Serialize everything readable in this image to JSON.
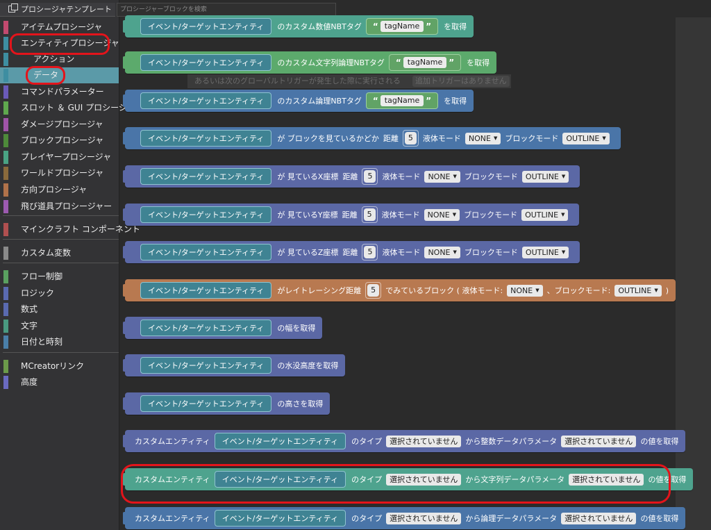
{
  "sidebar": {
    "template_tab": "プロシージャテンプレート",
    "categories": [
      {
        "label": "アイテムプロシージャ",
        "color": "#c24a6f"
      },
      {
        "label": "エンティティプロシージャ",
        "color": "#3e8ea1"
      },
      {
        "label": "アクション",
        "color": "#3e8ea1"
      },
      {
        "label": "データ",
        "color": "#3e8ea1"
      },
      {
        "label": "コマンドパラメーター",
        "color": "#6a5ab8"
      },
      {
        "label": "スロット ＆ GUI プロシージャ",
        "color": "#5fa84e"
      },
      {
        "label": "ダメージプロシージャ",
        "color": "#a054a8"
      },
      {
        "label": "ブロックプロシージャ",
        "color": "#4e8a3a"
      },
      {
        "label": "プレイヤープロシージャ",
        "color": "#4aa384"
      },
      {
        "label": "ワールドプロシージャ",
        "color": "#8a6a3c"
      },
      {
        "label": "方向プロシージャ",
        "color": "#b0724a"
      },
      {
        "label": "飛び道具プロシージャー",
        "color": "#9c5ab0"
      },
      {
        "label": "マインクラフト コンポーネント",
        "color": "#b05050"
      },
      {
        "label": "カスタム変数",
        "color": "#8a8a8a"
      },
      {
        "label": "フロー制御",
        "color": "#5aa060"
      },
      {
        "label": "ロジック",
        "color": "#5a6ab0"
      },
      {
        "label": "数式",
        "color": "#5a6ab0"
      },
      {
        "label": "文字",
        "color": "#4a9a80"
      },
      {
        "label": "日付と時刻",
        "color": "#4a7fa8"
      },
      {
        "label": "MCreatorリンク",
        "color": "#6b9a4a"
      },
      {
        "label": "高度",
        "color": "#6a6ac0"
      }
    ]
  },
  "search": {
    "placeholder": "プロシージャーブロックを検索"
  },
  "ghost": {
    "text": "あるいは次のグローバルトリガーが発生した際に実行される",
    "trigger": "追加トリガーはありません"
  },
  "common": {
    "entity": "イベント/ターゲットエンティティ",
    "custom_entity": "カスタムエンティティ",
    "tagname": "tagName",
    "five": "5",
    "none": "NONE",
    "outline": "OUTLINE",
    "not_selected": "選択されていません",
    "fluid_mode": "液体モード",
    "block_mode": "ブロックモード",
    "get": "を取得",
    "distance": "距離",
    "type_of": "のタイプ",
    "value_get": "の値を取得"
  },
  "blocks": {
    "b1": {
      "text": "のカスタム数値NBTタグ"
    },
    "b2": {
      "text": "のカスタム文字列論理NBTタグ"
    },
    "b3": {
      "text": "のカスタム論理NBTタグ"
    },
    "b4": {
      "text": "が ブロックを見ているかどか"
    },
    "b5": {
      "text": "が 見ているX座標"
    },
    "b6": {
      "text": "が 見ているY座標"
    },
    "b7": {
      "text": "が 見ているZ座標"
    },
    "b8": {
      "text": "がレイトレーシング距離",
      "text2": "でみているブロック ( 液体モード:",
      "text3": "、ブロックモード:",
      "close": ")"
    },
    "b9": {
      "text": "の幅を取得"
    },
    "b10": {
      "text": "の水没高度を取得"
    },
    "b11": {
      "text": "の高さを取得"
    },
    "b12": {
      "text": "から整数データパラメータ"
    },
    "b13": {
      "text": "から文字列データパラメータ"
    },
    "b14": {
      "text": "から論理データパラメータ"
    }
  }
}
